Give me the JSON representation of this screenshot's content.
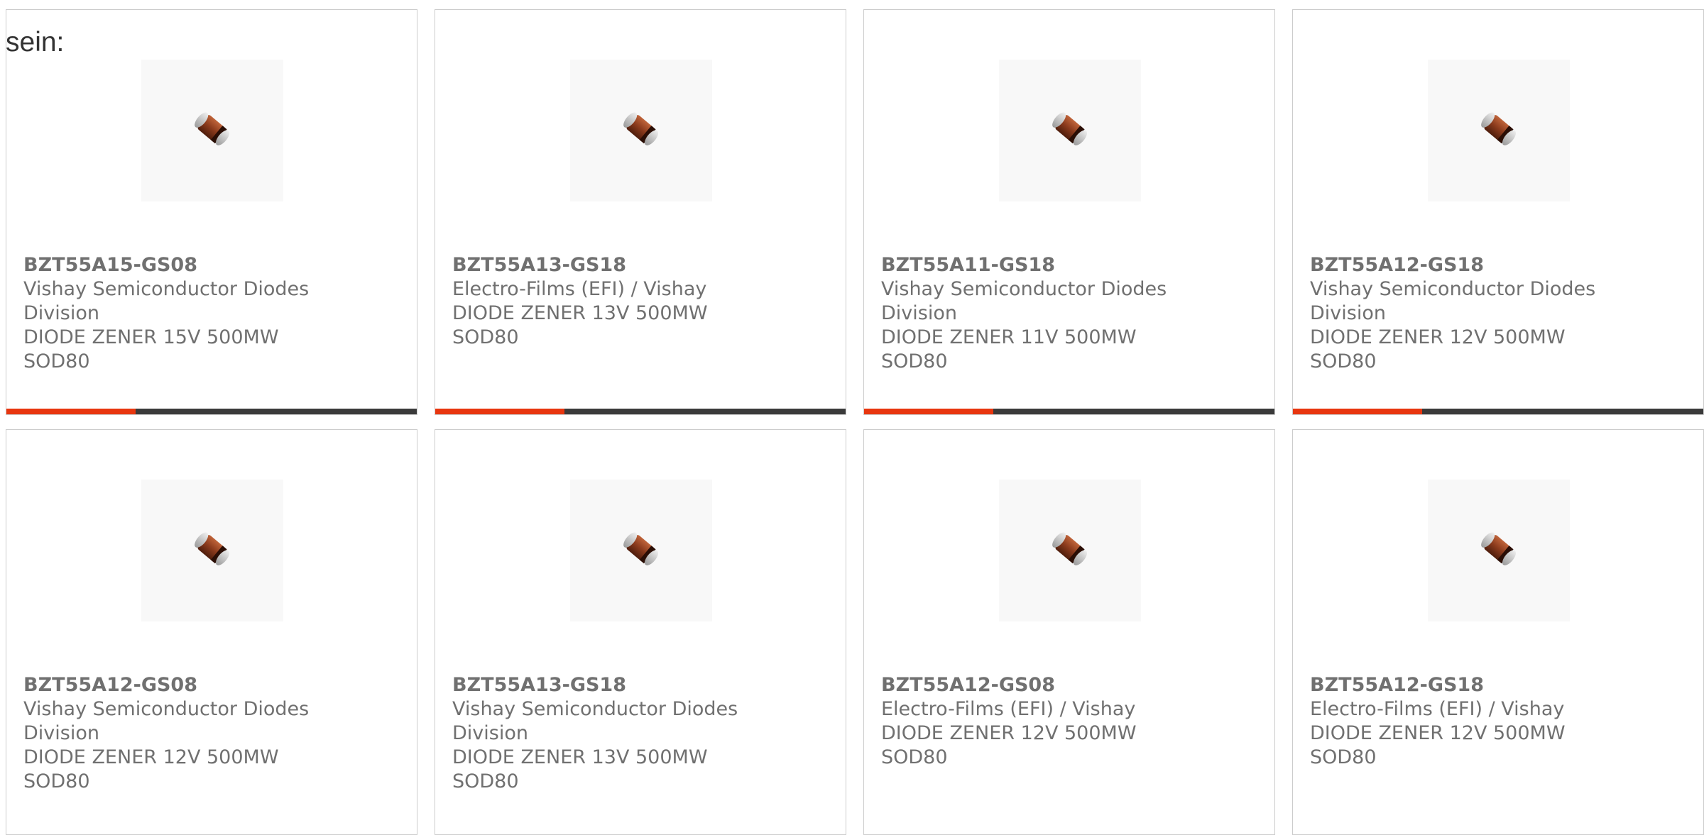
{
  "intro_text": "sein:",
  "products": [
    {
      "part": "BZT55A15-GS08",
      "manufacturer": [
        "Vishay Semiconductor Diodes",
        "Division"
      ],
      "description": [
        "DIODE ZENER 15V 500MW",
        "SOD80"
      ],
      "image_icon": "diode-sod80-icon",
      "progress": 0.315
    },
    {
      "part": "BZT55A13-GS18",
      "manufacturer": [
        "Electro-Films (EFI) / Vishay"
      ],
      "description": [
        "DIODE ZENER 13V 500MW",
        "SOD80"
      ],
      "image_icon": "diode-sod80-icon",
      "progress": 0.315
    },
    {
      "part": "BZT55A11-GS18",
      "manufacturer": [
        "Vishay Semiconductor Diodes",
        "Division"
      ],
      "description": [
        "DIODE ZENER 11V 500MW",
        "SOD80"
      ],
      "image_icon": "diode-sod80-icon",
      "progress": 0.315
    },
    {
      "part": "BZT55A12-GS18",
      "manufacturer": [
        "Vishay Semiconductor Diodes",
        "Division"
      ],
      "description": [
        "DIODE ZENER 12V 500MW",
        "SOD80"
      ],
      "image_icon": "diode-sod80-icon",
      "progress": 0.315
    },
    {
      "part": "BZT55A12-GS08",
      "manufacturer": [
        "Vishay Semiconductor Diodes",
        "Division"
      ],
      "description": [
        "DIODE ZENER 12V 500MW",
        "SOD80"
      ],
      "image_icon": "diode-sod80-icon"
    },
    {
      "part": "BZT55A13-GS18",
      "manufacturer": [
        "Vishay Semiconductor Diodes",
        "Division"
      ],
      "description": [
        "DIODE ZENER 13V 500MW",
        "SOD80"
      ],
      "image_icon": "diode-sod80-icon"
    },
    {
      "part": "BZT55A12-GS08",
      "manufacturer": [
        "Electro-Films (EFI) / Vishay"
      ],
      "description": [
        "DIODE ZENER 12V 500MW",
        "SOD80"
      ],
      "image_icon": "diode-sod80-icon"
    },
    {
      "part": "BZT55A12-GS18",
      "manufacturer": [
        "Electro-Films (EFI) / Vishay"
      ],
      "description": [
        "DIODE ZENER 12V 500MW",
        "SOD80"
      ],
      "image_icon": "diode-sod80-icon"
    }
  ],
  "colors": {
    "text": "#707070",
    "border": "#cccccc",
    "bar_track": "#3a3a3a",
    "bar_fill": "#e8360f"
  }
}
